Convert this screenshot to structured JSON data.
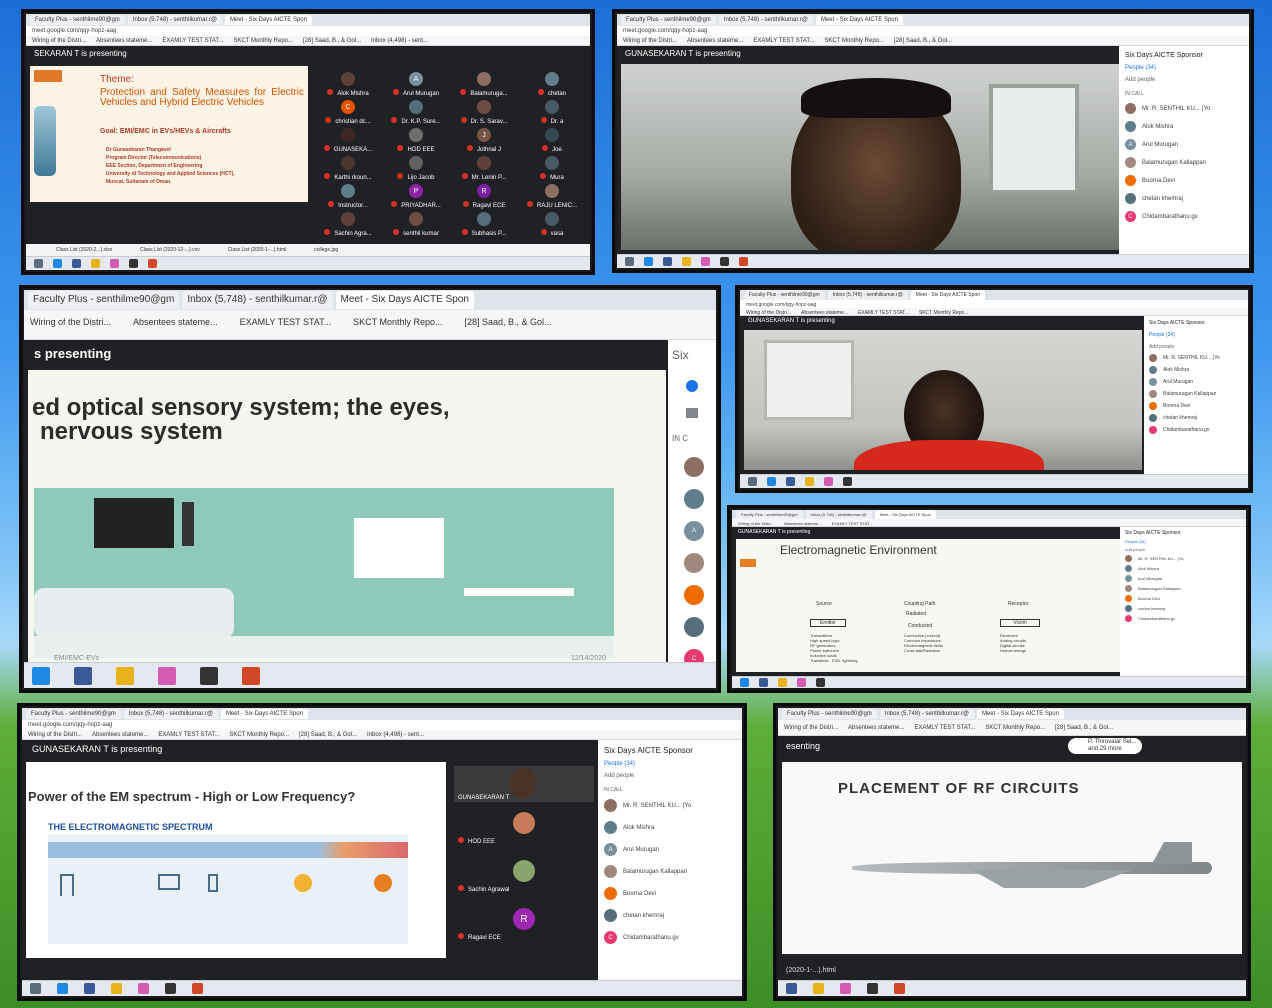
{
  "common": {
    "tab_faculty": "Faculty Plus - senthilme90@gm",
    "tab_inbox": "Inbox (5,748) - senthilkumar.r@",
    "tab_meet": "Meet - Six Days AICTE Spon",
    "url": "meet.google.com/qqy-hopz-aag",
    "bookmarks": [
      "Wiring of the Distri...",
      "Absentees stateme...",
      "EXAMLY TEST STAT...",
      "SKCT Monthly Repo...",
      "[28] Saad, B., & Gol...",
      "Inbox (4,498) - sent..."
    ],
    "presenting": "GUNASEKARAN T is presenting",
    "meet_title": "Six Days AICTE Sponsor",
    "people_label": "People (34)",
    "add_people": "Add people",
    "in_call": "IN CALL",
    "participants": [
      "Mr. R. SENTHIL KU... (Yo",
      "Alok Mishra",
      "Arul Murugan",
      "Balamurugan Kallappan",
      "Boorna Devi",
      "chetan khemraj",
      "Chidambarathanu.gv"
    ]
  },
  "p1": {
    "presenting": "SEKARAN T is presenting",
    "theme": "Theme:",
    "theme_body": "Protection and Safety Measures for Electric Vehicles and Hybrid Electric Vehicles",
    "goal": "Goal: EMI/EMC in EVs/HEVs & Aircrafts",
    "author": [
      "Dr Gunasekaran Thangavel",
      "Program Director (Telecommunications)",
      "EEE Section, Department of Engineering",
      "University of Technology and Applied Sciences (HCT),",
      "Muscat, Sultanate of Oman."
    ],
    "tiles": [
      {
        "name": "Alok Mishra"
      },
      {
        "name": "Arul Murugan",
        "initial": "A"
      },
      {
        "name": "Balamuruga..."
      },
      {
        "name": "chetan"
      },
      {
        "name": "christian dc...",
        "initial": "C"
      },
      {
        "name": "Dr. K.P. Sure..."
      },
      {
        "name": "Dr. S. Sarav..."
      },
      {
        "name": "Dr. a"
      },
      {
        "name": "GUNASEKA..."
      },
      {
        "name": "HOD EEE"
      },
      {
        "name": "Jothnal J",
        "initial": "J"
      },
      {
        "name": "Joe"
      },
      {
        "name": "Karthi rkoun..."
      },
      {
        "name": "Lijo Jacob"
      },
      {
        "name": "Mr. Lenin P..."
      },
      {
        "name": "Mura"
      },
      {
        "name": "Instructor..."
      },
      {
        "name": "PRIYADHAR...",
        "initial": "P"
      },
      {
        "name": "Ragavi ECE",
        "initial": "R"
      },
      {
        "name": "RAJU LENIC..."
      },
      {
        "name": "Sachin Agra..."
      },
      {
        "name": "senthil kumar"
      },
      {
        "name": "Subhasis P..."
      },
      {
        "name": "vasa"
      }
    ],
    "downloads": [
      "Class List (2020-2...).xlsx",
      "Class List (2020-12-...).csv",
      "Class List (2020-1-...).html",
      "college.jpg"
    ]
  },
  "p3": {
    "presenting": "s presenting",
    "slide_title_1": "ed optical sensory system; the eyes,",
    "slide_title_2": "nervous system",
    "footer_left": "EMI/EMC-EVs",
    "footer_right": "12/14/2020",
    "side_six": "Six",
    "side_in_call": "IN C"
  },
  "p5": {
    "slide_title": "Electromagnetic Environment",
    "labels": {
      "source": "Source",
      "path": "Coupling Path",
      "receptor": "Receptor",
      "emitter": "Emitter",
      "radiated": "Radiated",
      "conducted": "Conducted",
      "victim": "Victim"
    },
    "col_left": [
      "Transmitters",
      "High speed logic",
      "RF generators",
      "Power switchers",
      "Inductive loads",
      "Transients - ESD, lightning"
    ],
    "col_mid": [
      "Conductive (current)",
      "Common impedance",
      "Electromagnetic fields",
      "Cross-talk/Radiation"
    ],
    "col_right": [
      "Receivers",
      "Analog circuits",
      "Digital circuits",
      "Human beings"
    ]
  },
  "p6": {
    "slide_title": "Power of the EM spectrum - High or Low Frequency?",
    "banner": "THE ELECTROMAGNETIC SPECTRUM",
    "self_tile": "GUNASEKARAN T",
    "tiles": [
      {
        "name": "HOD EEE"
      },
      {
        "name": "Sachin Agrawal"
      },
      {
        "name": "Ragavi ECE",
        "initial": "R"
      }
    ]
  },
  "p7": {
    "presenting": "esenting",
    "presenter_chip": "P. Thiruvalar Sel...",
    "presenter_more": "and 29 more",
    "slide_title": "PLACEMENT OF RF CIRCUITS",
    "download": "(2020-1-...).html"
  }
}
